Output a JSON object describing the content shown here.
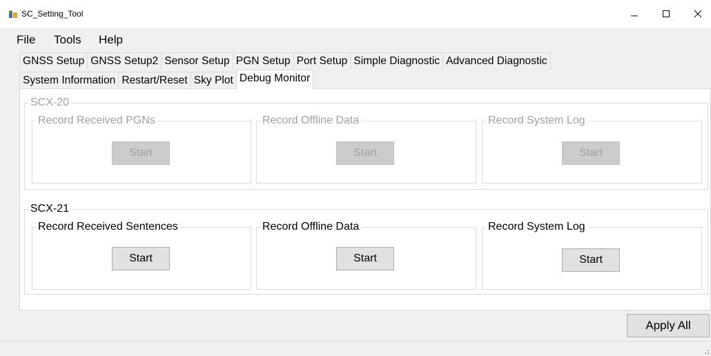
{
  "window": {
    "title": "SC_Setting_Tool",
    "icon": "app-logo-icon",
    "controls": [
      "minimize-icon",
      "maximize-icon",
      "close-icon"
    ]
  },
  "menu": {
    "items": [
      "File",
      "Tools",
      "Help"
    ]
  },
  "tabs": {
    "row1": [
      "GNSS Setup",
      "GNSS Setup2",
      "Sensor Setup",
      "PGN Setup",
      "Port Setup",
      "Simple Diagnostic",
      "Advanced Diagnostic"
    ],
    "row2": [
      "System Information",
      "Restart/Reset",
      "Sky Plot",
      "Debug Monitor"
    ],
    "active": "Debug Monitor"
  },
  "scx20": {
    "label": "SCX-20",
    "enabled": false,
    "groups": [
      {
        "label": "Record Received PGNs",
        "button": "Start"
      },
      {
        "label": "Record Offline Data",
        "button": "Start"
      },
      {
        "label": "Record System Log",
        "button": "Start"
      }
    ]
  },
  "scx21": {
    "label": "SCX-21",
    "enabled": true,
    "groups": [
      {
        "label": "Record Received Sentences",
        "button": "Start"
      },
      {
        "label": "Record Offline Data",
        "button": "Start"
      },
      {
        "label": "Record System Log",
        "button": "Start"
      }
    ]
  },
  "footer": {
    "apply_label": "Apply All"
  }
}
